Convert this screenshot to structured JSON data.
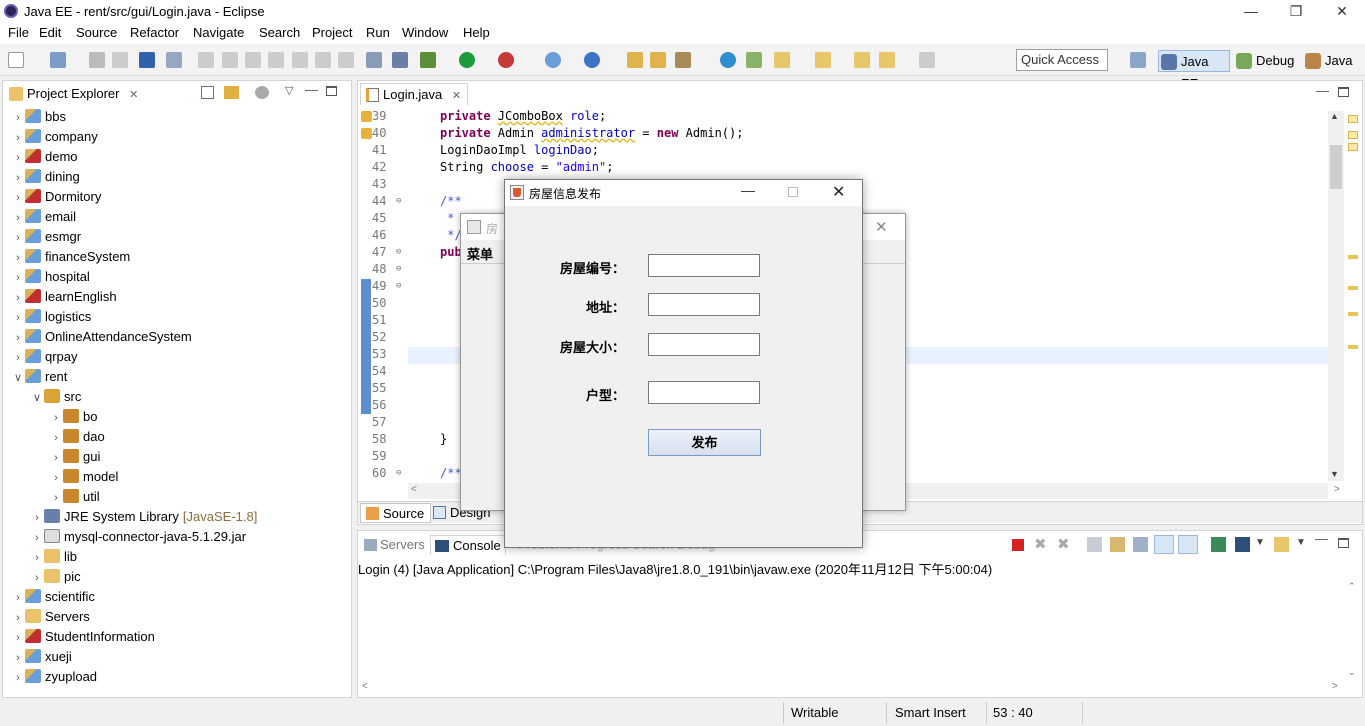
{
  "window": {
    "title": "Java EE - rent/src/gui/Login.java - Eclipse"
  },
  "menu": [
    "File",
    "Edit",
    "Source",
    "Refactor",
    "Navigate",
    "Search",
    "Project",
    "Run",
    "Window",
    "Help"
  ],
  "toolbar": {
    "quick_access": "Quick Access",
    "perspectives": [
      "Java EE",
      "Debug",
      "Java"
    ]
  },
  "explorer": {
    "title": "Project Explorer",
    "items": [
      {
        "label": "bbs",
        "depth": 0,
        "icon": "project-icon",
        "twisty": ">"
      },
      {
        "label": "company",
        "depth": 0,
        "icon": "project-icon",
        "twisty": ">"
      },
      {
        "label": "demo",
        "depth": 0,
        "icon": "project-error-icon",
        "twisty": ">"
      },
      {
        "label": "dining",
        "depth": 0,
        "icon": "project-icon",
        "twisty": ">"
      },
      {
        "label": "Dormitory",
        "depth": 0,
        "icon": "project-error-icon",
        "twisty": ">"
      },
      {
        "label": "email",
        "depth": 0,
        "icon": "project-icon",
        "twisty": ">"
      },
      {
        "label": "esmgr",
        "depth": 0,
        "icon": "project-icon",
        "twisty": ">"
      },
      {
        "label": "financeSystem",
        "depth": 0,
        "icon": "project-icon",
        "twisty": ">"
      },
      {
        "label": "hospital",
        "depth": 0,
        "icon": "project-icon",
        "twisty": ">"
      },
      {
        "label": "learnEnglish",
        "depth": 0,
        "icon": "project-error-icon",
        "twisty": ">"
      },
      {
        "label": "logistics",
        "depth": 0,
        "icon": "project-icon",
        "twisty": ">"
      },
      {
        "label": "OnlineAttendanceSystem",
        "depth": 0,
        "icon": "project-icon",
        "twisty": ">"
      },
      {
        "label": "qrpay",
        "depth": 0,
        "icon": "project-icon",
        "twisty": ">"
      },
      {
        "label": "rent",
        "depth": 0,
        "icon": "project-icon",
        "twisty": "v"
      },
      {
        "label": "src",
        "depth": 1,
        "icon": "source-folder-icon",
        "twisty": "v"
      },
      {
        "label": "bo",
        "depth": 2,
        "icon": "package-icon",
        "twisty": ">"
      },
      {
        "label": "dao",
        "depth": 2,
        "icon": "package-icon",
        "twisty": ">"
      },
      {
        "label": "gui",
        "depth": 2,
        "icon": "package-icon",
        "twisty": ">"
      },
      {
        "label": "model",
        "depth": 2,
        "icon": "package-icon",
        "twisty": ">"
      },
      {
        "label": "util",
        "depth": 2,
        "icon": "package-icon",
        "twisty": ">"
      },
      {
        "label": "JRE System Library",
        "suffix": "[JavaSE-1.8]",
        "depth": 1,
        "icon": "library-icon",
        "twisty": ">"
      },
      {
        "label": "mysql-connector-java-5.1.29.jar",
        "depth": 1,
        "icon": "jar-icon",
        "twisty": ">"
      },
      {
        "label": "lib",
        "depth": 1,
        "icon": "folder-icon",
        "twisty": ">"
      },
      {
        "label": "pic",
        "depth": 1,
        "icon": "folder-icon",
        "twisty": ">"
      },
      {
        "label": "scientific",
        "depth": 0,
        "icon": "project-icon",
        "twisty": ">"
      },
      {
        "label": "Servers",
        "depth": 0,
        "icon": "folder-icon",
        "twisty": ">"
      },
      {
        "label": "StudentInformation",
        "depth": 0,
        "icon": "project-error-icon",
        "twisty": ">"
      },
      {
        "label": "xueji",
        "depth": 0,
        "icon": "project-icon",
        "twisty": ">"
      },
      {
        "label": "zyupload",
        "depth": 0,
        "icon": "project-icon",
        "twisty": ">"
      }
    ]
  },
  "editor": {
    "tab": "Login.java",
    "line_numbers": [
      "39",
      "40",
      "41",
      "42",
      "43",
      "44",
      "45",
      "46",
      "47",
      "48",
      "49",
      "50",
      "51",
      "52",
      "53",
      "54",
      "55",
      "56",
      "57",
      "58",
      "59",
      "60"
    ],
    "code": {
      "l39a": "private ",
      "l39b": "JComboBox",
      "l39c": " ",
      "l39d": "role",
      "l39e": ";",
      "l40a": "private ",
      "l40b": "Admin ",
      "l40c": "administrator",
      "l40d": " = ",
      "l40e": "new ",
      "l40f": "Admin();",
      "l41a": "LoginDaoImpl ",
      "l41b": "loginDao",
      "l41c": ";",
      "l42a": "String ",
      "l42b": "choose",
      "l42c": " = ",
      "l42d": "\"admin\"",
      "l42e": ";",
      "l44": "/**",
      "l45": " *",
      "l46": " */",
      "l47": "pub",
      "l58": "}",
      "l60": "/**"
    },
    "bottom_tabs": [
      "Source",
      "Design"
    ]
  },
  "console": {
    "tabs": [
      "Servers",
      "Console"
    ],
    "hidden_tabs": "Problems  Progress  Search  Debug",
    "launch_text": "Login (4) [Java Application] C:\\Program Files\\Java8\\jre1.8.0_191\\bin\\javaw.exe (2020年11月12日 下午5:00:04)"
  },
  "status": {
    "writable": "Writable",
    "insert": "Smart Insert",
    "position": "53 : 40"
  },
  "dialog_back": {
    "title": "房",
    "menu": "菜单"
  },
  "dialog": {
    "title": "房屋信息发布",
    "fields": [
      {
        "label": "房屋编号：",
        "value": ""
      },
      {
        "label": "地址：",
        "value": ""
      },
      {
        "label": "房屋大小：",
        "value": ""
      },
      {
        "label": "户型：",
        "value": ""
      }
    ],
    "submit": "发布"
  }
}
